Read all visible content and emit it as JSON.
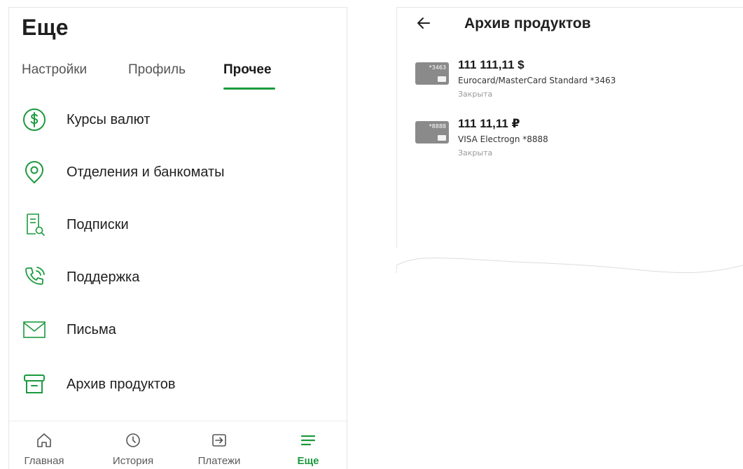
{
  "left": {
    "title": "Еще",
    "tabs": [
      {
        "label": "Настройки"
      },
      {
        "label": "Профиль"
      },
      {
        "label": "Прочее",
        "active": true
      }
    ],
    "menu": [
      {
        "label": "Курсы валют",
        "icon": "currency-icon"
      },
      {
        "label": "Отделения и банкоматы",
        "icon": "location-pin-icon"
      },
      {
        "label": "Подписки",
        "icon": "document-search-icon"
      },
      {
        "label": "Поддержка",
        "icon": "phone-call-icon"
      },
      {
        "label": "Письма",
        "icon": "envelope-icon"
      },
      {
        "label": "Архив продуктов",
        "icon": "archive-box-icon"
      }
    ],
    "bottom_nav": [
      {
        "label": "Главная",
        "icon": "home-icon"
      },
      {
        "label": "История",
        "icon": "clock-icon"
      },
      {
        "label": "Платежи",
        "icon": "transfer-icon"
      },
      {
        "label": "Еще",
        "icon": "menu-icon",
        "active": true
      }
    ]
  },
  "right": {
    "title": "Архив продуктов",
    "products": [
      {
        "card_number": "*3463",
        "amount": "111 111,11 $",
        "name": "Eurocard/MasterCard Standard *3463",
        "status": "Закрыта"
      },
      {
        "card_number": "*8888",
        "amount": "111 11,11 ₽",
        "name": "VISA Electrogn *8888",
        "status": "Закрыта"
      }
    ]
  },
  "colors": {
    "accent": "#1b9a3e",
    "card": "#8a8a8a",
    "muted": "#9a9a9a"
  }
}
